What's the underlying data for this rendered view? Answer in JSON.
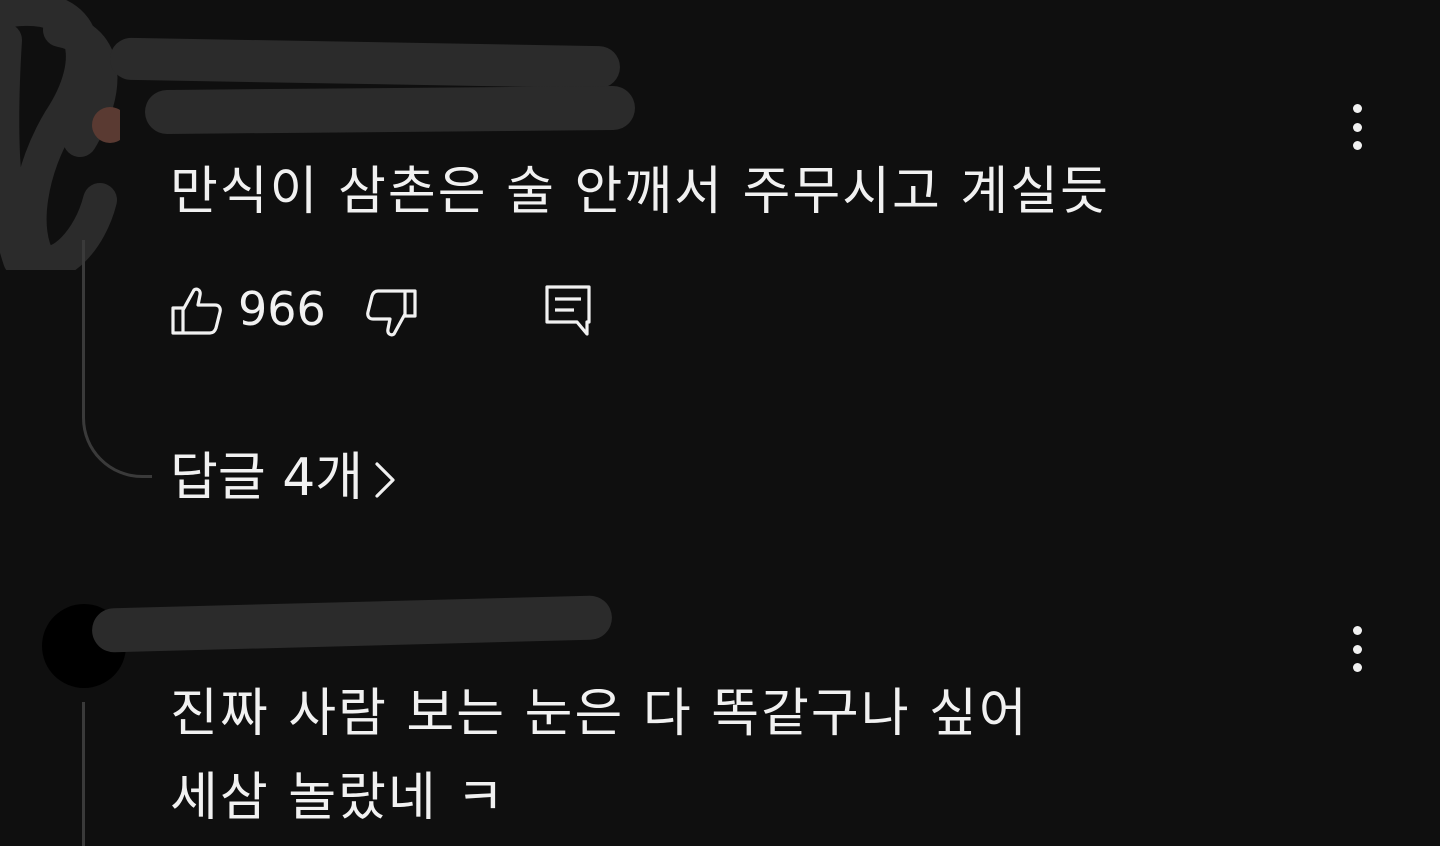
{
  "comments": [
    {
      "text": "만식이 삼촌은 술 안깨서 주무시고 계실듯",
      "like_count": "966",
      "replies_label": "답글 4개"
    },
    {
      "text_line1": "진짜 사람 보는 눈은 다 똑같구나 싶어",
      "text_line2": "세삼 놀랐네 ㅋ"
    }
  ],
  "icons": {
    "more": "more-vert-icon",
    "like": "thumb-up-icon",
    "dislike": "thumb-down-icon",
    "reply": "comment-reply-icon",
    "chevron": "chevron-right-icon"
  },
  "colors": {
    "background": "#0f0f0f",
    "text": "#f1f1f1",
    "redaction": "#2b2b2b"
  }
}
